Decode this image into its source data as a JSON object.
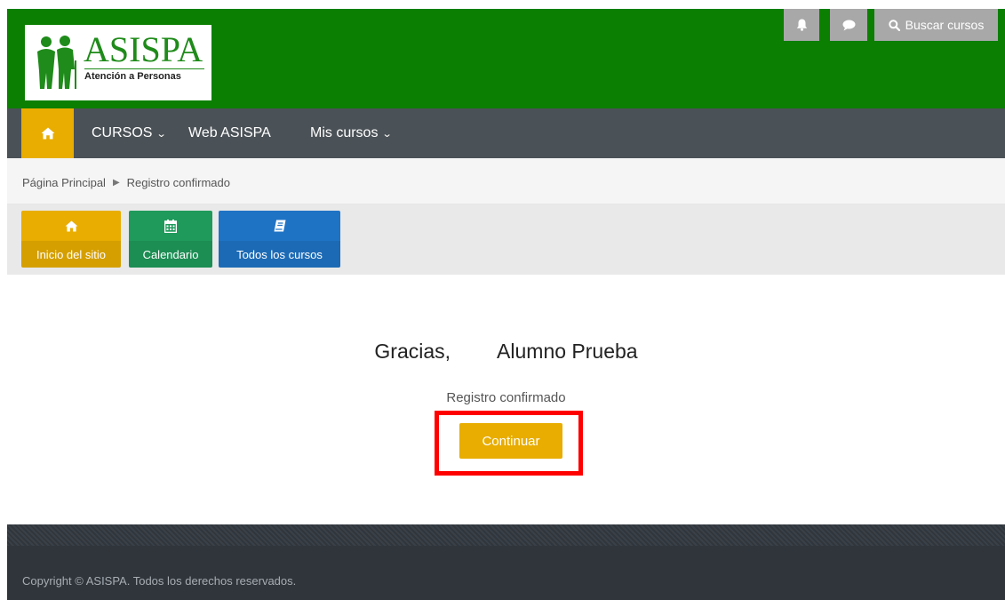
{
  "header": {
    "logo": {
      "name": "ASISPA",
      "subtitle": "Atención a Personas"
    },
    "icons": {
      "bell": "bell-icon",
      "chat": "chat-icon",
      "search": "search-icon"
    },
    "search_label": "Buscar cursos",
    "color": "#0b7f01"
  },
  "nav": {
    "home_icon": "home-icon",
    "items": [
      {
        "label": "CURSOS",
        "has_dropdown": true
      },
      {
        "label": "Web ASISPA",
        "has_dropdown": false
      },
      {
        "label": "Mis cursos",
        "has_dropdown": true
      }
    ]
  },
  "breadcrumb": {
    "items": [
      "Página Principal",
      "Registro confirmado"
    ]
  },
  "quick_links": [
    {
      "label": "Inicio del sitio",
      "icon": "home-icon",
      "color": "#e8ad00"
    },
    {
      "label": "Calendario",
      "icon": "calendar-icon",
      "color": "#1f9a5b"
    },
    {
      "label": "Todos los cursos",
      "icon": "book-icon",
      "color": "#1f73c5"
    }
  ],
  "main": {
    "thanks": "Gracias,",
    "user_name": "Alumno Prueba",
    "confirmed_text": "Registro confirmado",
    "continue_label": "Continuar"
  },
  "footer": {
    "copyright": "Copyright © ASISPA. Todos los derechos reservados."
  }
}
